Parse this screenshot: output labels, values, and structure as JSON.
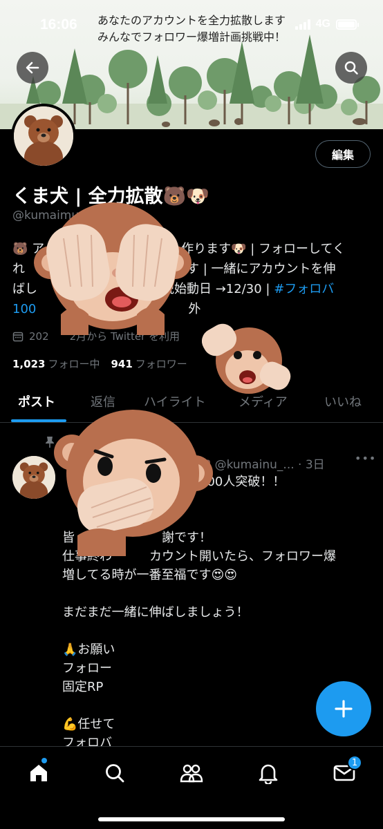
{
  "status_bar": {
    "time": "16:06",
    "network": "4G"
  },
  "banner": {
    "line1": "あなたのアカウントを全力拡散します",
    "line2": "みんなでフォロワー爆増計画挑戦中！"
  },
  "profile": {
    "edit_label": "編集",
    "display_name": "くま犬 | 全力拡散🐻🐶",
    "handle": "@kumaimu_",
    "bio_lines": [
      "🐻 ア　　　　　　　　　　　作ります🐶 | フォローしてく",
      "れ　　　　　　　　　　　します | 一緒にアカウントを伸",
      "ばし　　　　　　　　　　説始動日 →12/30 | "
    ],
    "bio_hashtag": "#フォロバ",
    "bio_line4": "100",
    "bio_line4_tail": "外",
    "joined": "202　　2月から Twitter を利用",
    "following_count": "1,023",
    "following_label": "フォロー中",
    "followers_count": "941",
    "followers_label": "フォロワー"
  },
  "tabs": [
    {
      "label": "ポスト",
      "active": true
    },
    {
      "label": "返信",
      "active": false
    },
    {
      "label": "ハイライト",
      "active": false
    },
    {
      "label": "メディア",
      "active": false
    },
    {
      "label": "いいね",
      "active": false
    }
  ],
  "post": {
    "meta": "🐶 @kumainu_... · 3日",
    "more": "•••",
    "lines": [
      "　　　　　　　　ロワー900人突破！！",
      "",
      "　　　　　　　　　　　　",
      "皆　　　　　　　謝です！",
      "仕事終わ　　　カウント開いたら、フォロワー爆",
      "増してる時が一番至福です😍😍",
      "",
      "まだまだ一緒に伸ばしましょう！",
      "",
      "🙏お願い",
      "フォロー",
      "固定RP",
      "",
      "💪任せて",
      "フォロバ"
    ]
  },
  "bottom_nav": {
    "items": [
      "home-icon",
      "search-icon",
      "communities-icon",
      "notifications-icon",
      "messages-icon"
    ],
    "messages_badge": "1"
  },
  "colors": {
    "accent": "#1d9bf0",
    "background": "#000000",
    "muted": "#71767b"
  }
}
